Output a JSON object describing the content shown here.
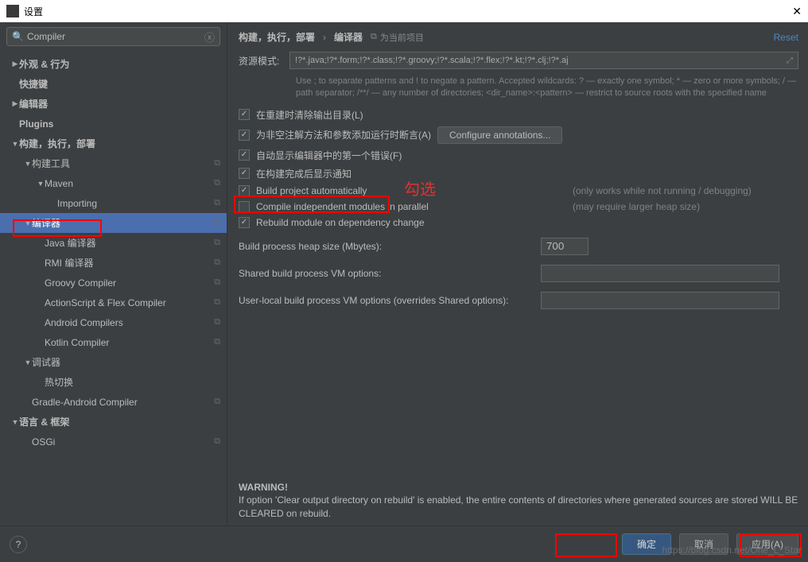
{
  "window": {
    "title": "设置"
  },
  "search": {
    "value": "Compiler"
  },
  "sidebar": {
    "items": [
      {
        "label": "外观 & 行为",
        "bold": true,
        "arrow": "▶",
        "indent": 0,
        "copy": false
      },
      {
        "label": "快捷键",
        "bold": true,
        "arrow": "",
        "indent": 0,
        "copy": false
      },
      {
        "label": "编辑器",
        "bold": true,
        "arrow": "▶",
        "indent": 0,
        "copy": false
      },
      {
        "label": "Plugins",
        "bold": true,
        "arrow": "",
        "indent": 0,
        "copy": false
      },
      {
        "label": "构建，执行，部署",
        "bold": true,
        "arrow": "▼",
        "indent": 0,
        "copy": false
      },
      {
        "label": "构建工具",
        "bold": false,
        "arrow": "▼",
        "indent": 1,
        "copy": true
      },
      {
        "label": "Maven",
        "bold": false,
        "arrow": "▼",
        "indent": 2,
        "copy": true
      },
      {
        "label": "Importing",
        "bold": false,
        "arrow": "",
        "indent": 3,
        "copy": true
      },
      {
        "label": "编译器",
        "bold": false,
        "arrow": "▼",
        "indent": 1,
        "copy": true,
        "selected": true
      },
      {
        "label": "Java 编译器",
        "bold": false,
        "arrow": "",
        "indent": 2,
        "copy": true
      },
      {
        "label": "RMI 编译器",
        "bold": false,
        "arrow": "",
        "indent": 2,
        "copy": true
      },
      {
        "label": "Groovy Compiler",
        "bold": false,
        "arrow": "",
        "indent": 2,
        "copy": true
      },
      {
        "label": "ActionScript & Flex Compiler",
        "bold": false,
        "arrow": "",
        "indent": 2,
        "copy": true
      },
      {
        "label": "Android Compilers",
        "bold": false,
        "arrow": "",
        "indent": 2,
        "copy": true
      },
      {
        "label": "Kotlin Compiler",
        "bold": false,
        "arrow": "",
        "indent": 2,
        "copy": true
      },
      {
        "label": "调试器",
        "bold": false,
        "arrow": "▼",
        "indent": 1,
        "copy": false
      },
      {
        "label": "热切换",
        "bold": false,
        "arrow": "",
        "indent": 2,
        "copy": false
      },
      {
        "label": "Gradle-Android Compiler",
        "bold": false,
        "arrow": "",
        "indent": 1,
        "copy": true
      },
      {
        "label": "语言 & 框架",
        "bold": true,
        "arrow": "▼",
        "indent": 0,
        "copy": false
      },
      {
        "label": "OSGi",
        "bold": false,
        "arrow": "",
        "indent": 1,
        "copy": true
      }
    ]
  },
  "breadcrumb": {
    "path1": "构建，执行，部署",
    "sep": "›",
    "path2": "编译器",
    "project": "为当前项目",
    "reset": "Reset"
  },
  "resource": {
    "label": "资源模式:",
    "pattern": "!?*.java;!?*.form;!?*.class;!?*.groovy;!?*.scala;!?*.flex;!?*.kt;!?*.clj;!?*.aj",
    "hint": "Use ; to separate patterns and ! to negate a pattern. Accepted wildcards: ? — exactly one symbol; * — zero or more symbols; / — path separator; /**/ — any number of directories; <dir_name>:<pattern> — restrict to source roots with the specified name"
  },
  "checks": {
    "c1": {
      "label": "在重建时清除输出目录(L)",
      "checked": true
    },
    "c2": {
      "label": "为非空注解方法和参数添加运行时断言(A)",
      "checked": true,
      "btn": "Configure annotations..."
    },
    "c3": {
      "label": "自动显示编辑器中的第一个错误(F)",
      "checked": true
    },
    "c4": {
      "label": "在构建完成后显示通知",
      "checked": true
    },
    "c5": {
      "label": "Build project automatically",
      "checked": true,
      "note": "(only works while not running / debugging)"
    },
    "c6": {
      "label": "Compile independent modules in parallel",
      "checked": false,
      "note": "(may require larger heap size)"
    },
    "c7": {
      "label": "Rebuild module on dependency change",
      "checked": true
    }
  },
  "fields": {
    "heap": {
      "label": "Build process heap size (Mbytes):",
      "value": "700"
    },
    "shared": {
      "label": "Shared build process VM options:",
      "value": ""
    },
    "userlocal": {
      "label": "User-local build process VM options (overrides Shared options):",
      "value": ""
    }
  },
  "warning": {
    "title": "WARNING!",
    "text": "If option 'Clear output directory on rebuild' is enabled, the entire contents of directories where generated sources are stored WILL BE CLEARED on rebuild."
  },
  "footer": {
    "ok": "确定",
    "cancel": "取消",
    "apply": "应用(A)"
  },
  "annot": "勾选",
  "watermark": "https://blog.csdn.net/One_L_Star"
}
